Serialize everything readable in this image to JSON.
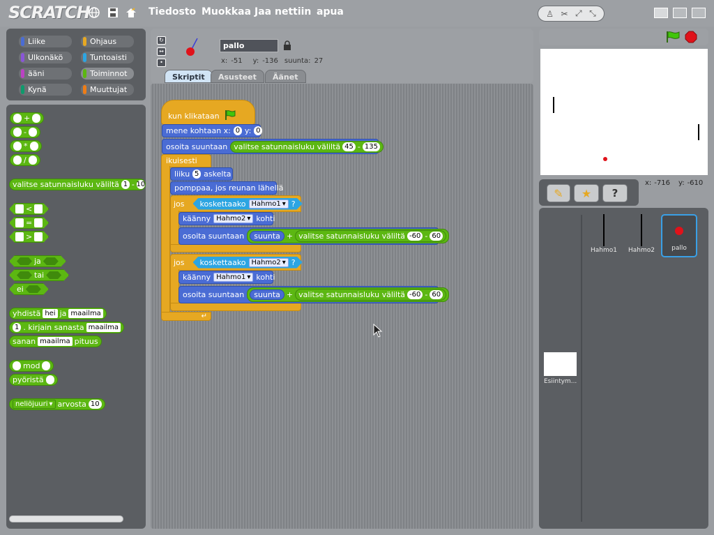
{
  "app": {
    "logo": "SCRATCH"
  },
  "menu": {
    "file": "Tiedosto",
    "edit": "Muokkaa",
    "share": "Jaa nettiin",
    "help": "apua"
  },
  "categories": [
    {
      "label": "Liike",
      "color": "#4a6cd4"
    },
    {
      "label": "Ohjaus",
      "color": "#e6a822"
    },
    {
      "label": "Ulkonäkö",
      "color": "#8a55d7"
    },
    {
      "label": "Tuntoaisti",
      "color": "#2ca5e2"
    },
    {
      "label": "ääni",
      "color": "#bb42c3"
    },
    {
      "label": "Toiminnot",
      "color": "#5cb712"
    },
    {
      "label": "Kynä",
      "color": "#0e9a6c"
    },
    {
      "label": "Muuttujat",
      "color": "#ee7d16"
    }
  ],
  "palette": {
    "add": "+",
    "sub": "-",
    "mul": "*",
    "div": "/",
    "random_label": "valitse satunnaisluku väliltä",
    "random_from": "1",
    "random_dash": "-",
    "random_to": "10",
    "lt": "<",
    "eq": "=",
    "gt": ">",
    "and": "ja",
    "or": "tai",
    "not": "ei",
    "join_label": "yhdistä",
    "join_a": "hei",
    "join_mid": "ja",
    "join_b": "maailma",
    "letter_n": "1",
    "letter_label": ". kirjain sanasta",
    "letter_word": "maailma",
    "length_label": "sanan",
    "length_word": "maailma",
    "length_suffix": "pituus",
    "mod_label": "mod",
    "round_label": "pyöristä",
    "sqrt_op": "neliöjuuri",
    "sqrt_label": "arvosta",
    "sqrt_value": "10"
  },
  "sprite_info": {
    "name": "pallo",
    "x_label": "x:",
    "x": "-51",
    "y_label": "y:",
    "y": "-136",
    "dir_label": "suunta:",
    "dir": "27"
  },
  "tabs": {
    "scripts": "Skriptit",
    "costumes": "Asusteet",
    "sounds": "Äänet"
  },
  "script": {
    "hat": "kun klikataan",
    "goto_label": "mene kohtaan x:",
    "goto_x": "0",
    "goto_y_label": "y:",
    "goto_y": "0",
    "point_label": "osoita suuntaan",
    "random_label": "valitse satunnaisluku väliltä",
    "point_from": "45",
    "dash": "-",
    "point_to": "135",
    "forever": "ikuisesti",
    "move_label": "liiku",
    "move_steps": "5",
    "move_suffix": "askelta",
    "bounce": "pomppaa, jos reunan lähellä",
    "if_label": "jos",
    "touching_label": "koskettaako",
    "touching_1": "Hahmo1",
    "touching_2": "Hahmo2",
    "qmark": "?",
    "turn_label": "käänny",
    "turn_suffix": "kohti",
    "turn_1": "Hahmo2",
    "turn_2": "Hahmo1",
    "direction": "suunta",
    "plus": "+",
    "rand_from": "-60",
    "rand_to": "60"
  },
  "stage_coords": {
    "x_label": "x:",
    "x": "-716",
    "y_label": "y:",
    "y": "-610"
  },
  "sprites": [
    {
      "name": "Hahmo1"
    },
    {
      "name": "Hahmo2"
    },
    {
      "name": "pallo"
    }
  ],
  "stage_thumb": {
    "label": "Esiintym..."
  }
}
